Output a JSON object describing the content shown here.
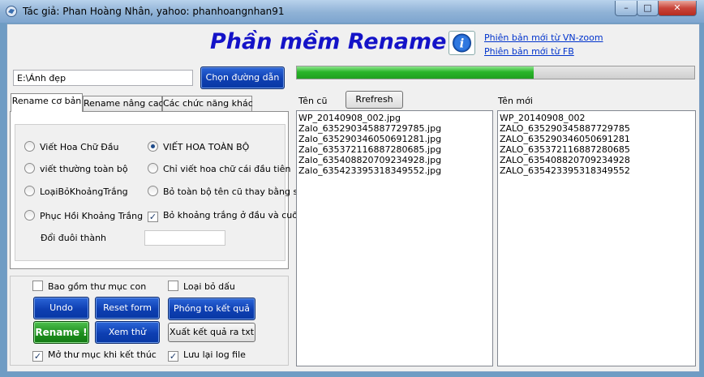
{
  "window": {
    "title": "Tác giả: Phan Hoàng Nhân, yahoo: phanhoangnhan91",
    "minimize": "–",
    "maximize": "□",
    "close": "✕"
  },
  "header": {
    "app_title": "Phần mềm Rename",
    "info_icon": "info-icon",
    "link_vnzoom": "Phiên bản mới từ VN-zoom",
    "link_fb": "Phiên bản mới từ FB"
  },
  "path": {
    "value": "E:\\Ảnh đẹp",
    "choose_button": "Chọn đường dẫn"
  },
  "progress": {
    "fraction": 0.595
  },
  "tabs": [
    {
      "label": "Rename cơ bản",
      "active": true
    },
    {
      "label": "Rename nâng cao",
      "active": false
    },
    {
      "label": "Các chức năng khác",
      "active": false
    }
  ],
  "options": {
    "capitalize_first": "Viết Hoa Chữ Đầu",
    "uppercase_all": "VIẾT HOA TOÀN BỘ",
    "lowercase_all": "viết thường toàn bộ",
    "capitalize_first_letter_only": "Chỉ viết hoa chữ cái đầu tiên",
    "remove_spaces": "LoạiBỏKhoảngTrắng",
    "replace_old_name": "Bỏ toàn bộ tên cũ thay bằng số",
    "restore_spaces": "Phục Hồi Khoảng Trắng",
    "trim_spaces": "Bỏ khoảng trắng ở đầu và cuối",
    "change_extension": "Đổi đuôi thành",
    "selected": "uppercase_all",
    "trim_checked": true
  },
  "bottom": {
    "include_subfolders": "Bao gồm thư mục con",
    "include_subfolders_checked": false,
    "remove_accents": "Loại bỏ dấu",
    "remove_accents_checked": false,
    "undo": "Undo",
    "reset": "Reset form",
    "rename": "Rename !",
    "preview": "Xem thử trước",
    "open_result": "Phóng to kết quả",
    "export": "Xuất kết quả ra txt",
    "open_folder": "Mở thư mục khi kết thúc",
    "open_folder_checked": true,
    "save_log": "Lưu lại log file",
    "save_log_checked": true
  },
  "lists": {
    "old_label": "Tên cũ",
    "refresh": "Rrefresh",
    "new_label": "Tên mới",
    "old_names": [
      "WP_20140908_002.jpg",
      "Zalo_635290345887729785.jpg",
      "Zalo_635290346050691281.jpg",
      "Zalo_635372116887280685.jpg",
      "Zalo_635408820709234928.jpg",
      "Zalo_635423395318349552.jpg"
    ],
    "new_names": [
      "WP_20140908_002",
      "ZALO_635290345887729785",
      "ZALO_635290346050691281",
      "ZALO_635372116887280685",
      "ZALO_635408820709234928",
      "ZALO_635423395318349552"
    ]
  }
}
